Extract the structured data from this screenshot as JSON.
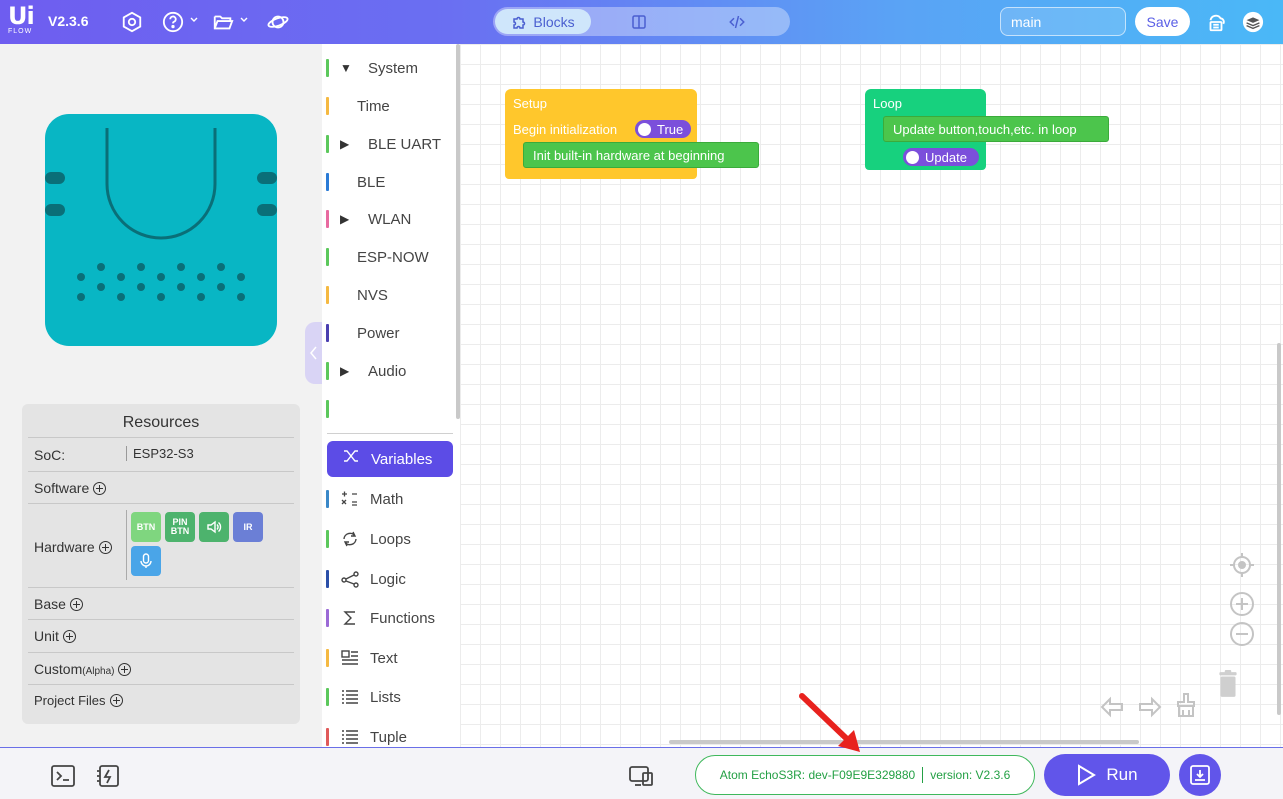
{
  "header": {
    "logo_top": "Ui",
    "logo_bottom": "FLOW",
    "version": "V2.3.6",
    "modes": [
      {
        "label": "Blocks",
        "icon": "puzzle-icon",
        "active": true
      },
      {
        "label": "",
        "icon": "split-view-icon",
        "active": false
      },
      {
        "label": "",
        "icon": "code-icon",
        "active": false
      }
    ],
    "branch_value": "main",
    "save_label": "Save"
  },
  "resources": {
    "title": "Resources",
    "soc_label": "SoC:",
    "soc_value": "ESP32-S3",
    "software_label": "Software",
    "hardware_label": "Hardware",
    "hardware_chips": [
      {
        "label": "BTN",
        "color": "#7fd67f"
      },
      {
        "label": "PIN BTN",
        "color": "#4db36d"
      },
      {
        "label": "",
        "icon": "speaker-icon",
        "color": "#4db36d"
      },
      {
        "label": "IR",
        "color": "#6b7fd6"
      },
      {
        "label": "",
        "icon": "mic-icon",
        "color": "#4aa5e8"
      }
    ],
    "base_label": "Base",
    "unit_label": "Unit",
    "custom_label": "Custom",
    "custom_suffix": "(Alpha)",
    "project_files_label": "Project Files"
  },
  "toolbox": {
    "categories": [
      {
        "label": "System",
        "color": "#5cc85c",
        "expand": "▼"
      },
      {
        "label": "Time",
        "color": "#f5b942"
      },
      {
        "label": "BLE UART",
        "color": "#5cc85c",
        "expand": "▶"
      },
      {
        "label": "BLE",
        "color": "#2b7bd6"
      },
      {
        "label": "WLAN",
        "color": "#e86aa0",
        "expand": "▶"
      },
      {
        "label": "ESP-NOW",
        "color": "#5cc85c"
      },
      {
        "label": "NVS",
        "color": "#f5b942"
      },
      {
        "label": "Power",
        "color": "#4a3fb0"
      },
      {
        "label": "Audio",
        "color": "#5cc85c",
        "expand": "▶"
      },
      {
        "label": "Variables",
        "color": "#5c4ce6",
        "icon": "variable-icon",
        "active": true
      },
      {
        "label": "Math",
        "color": "#3a88c8",
        "icon": "math-icon"
      },
      {
        "label": "Loops",
        "color": "#5cc85c",
        "icon": "loops-icon"
      },
      {
        "label": "Logic",
        "color": "#2b4fa8",
        "icon": "logic-icon"
      },
      {
        "label": "Functions",
        "color": "#9b6ad6",
        "icon": "sigma-icon"
      },
      {
        "label": "Text",
        "color": "#f5b942",
        "icon": "text-icon"
      },
      {
        "label": "Lists",
        "color": "#5cc85c",
        "icon": "list-icon"
      },
      {
        "label": "Tuple",
        "color": "#e05a5a",
        "icon": "list-icon"
      }
    ]
  },
  "workspace": {
    "setup": {
      "title": "Setup",
      "begin_label": "Begin initialization",
      "toggle_label": "True",
      "stmt": "Init built-in hardware at beginning"
    },
    "loop": {
      "title": "Loop",
      "stmt": "Update button,touch,etc. in loop",
      "toggle_label": "Update"
    }
  },
  "statusbar": {
    "device_label": "Atom EchoS3R: dev-F09E9E329880",
    "version_label": "version: V2.3.6",
    "run_label": "Run"
  },
  "colors": {
    "accent": "#6155ea",
    "setup_block": "#ffc72c",
    "loop_block": "#17d17e",
    "device": "#08b6c4",
    "status_green": "#24a045"
  }
}
